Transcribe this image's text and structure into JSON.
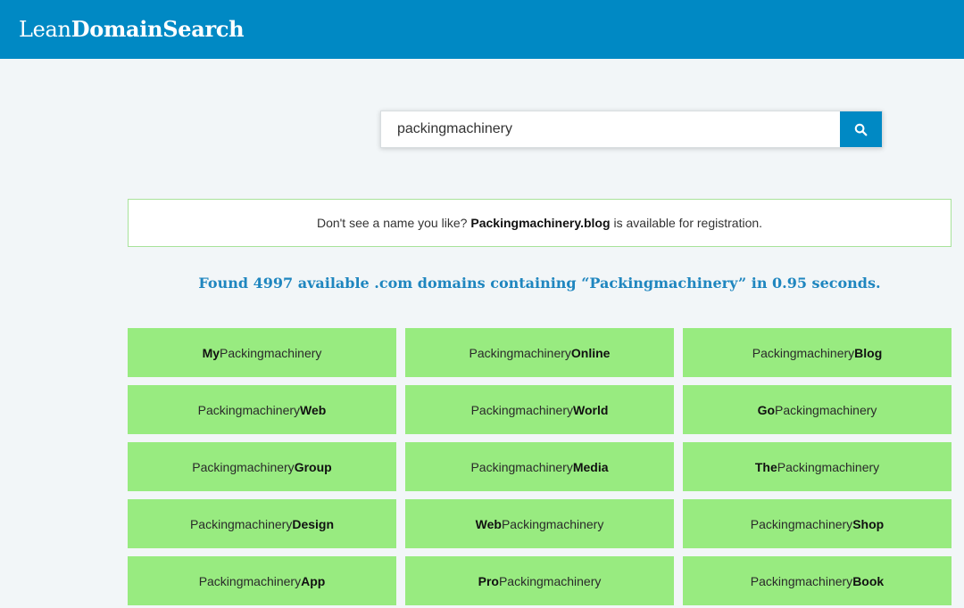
{
  "header": {
    "logo_light": "Lean",
    "logo_bold": "DomainSearch",
    "background": "#0089c4"
  },
  "search": {
    "value": "packingmachinery",
    "button_icon": "search-icon"
  },
  "notice": {
    "prefix": "Don't see a name you like?",
    "domain": "Packingmachinery.blog",
    "suffix": "is available for registration."
  },
  "results": {
    "summary": "Found 4997 available .com domains containing “Packingmachinery” in 0.95 seconds.",
    "card_color": "#98eb80",
    "items": [
      {
        "prefix": "My",
        "prefix_bold": true,
        "base": "Packingmachinery",
        "suffix": "",
        "suffix_bold": false
      },
      {
        "prefix": "",
        "prefix_bold": false,
        "base": "Packingmachinery",
        "suffix": "Online",
        "suffix_bold": true
      },
      {
        "prefix": "",
        "prefix_bold": false,
        "base": "Packingmachinery",
        "suffix": "Blog",
        "suffix_bold": true
      },
      {
        "prefix": "",
        "prefix_bold": false,
        "base": "Packingmachinery",
        "suffix": "Web",
        "suffix_bold": true
      },
      {
        "prefix": "",
        "prefix_bold": false,
        "base": "Packingmachinery",
        "suffix": "World",
        "suffix_bold": true
      },
      {
        "prefix": "Go",
        "prefix_bold": true,
        "base": "Packingmachinery",
        "suffix": "",
        "suffix_bold": false
      },
      {
        "prefix": "",
        "prefix_bold": false,
        "base": "Packingmachinery",
        "suffix": "Group",
        "suffix_bold": true
      },
      {
        "prefix": "",
        "prefix_bold": false,
        "base": "Packingmachinery",
        "suffix": "Media",
        "suffix_bold": true
      },
      {
        "prefix": "The",
        "prefix_bold": true,
        "base": "Packingmachinery",
        "suffix": "",
        "suffix_bold": false
      },
      {
        "prefix": "",
        "prefix_bold": false,
        "base": "Packingmachinery",
        "suffix": "Design",
        "suffix_bold": true
      },
      {
        "prefix": "Web",
        "prefix_bold": true,
        "base": "Packingmachinery",
        "suffix": "",
        "suffix_bold": false
      },
      {
        "prefix": "",
        "prefix_bold": false,
        "base": "Packingmachinery",
        "suffix": "Shop",
        "suffix_bold": true
      },
      {
        "prefix": "",
        "prefix_bold": false,
        "base": "Packingmachinery",
        "suffix": "App",
        "suffix_bold": true
      },
      {
        "prefix": "Pro",
        "prefix_bold": true,
        "base": "Packingmachinery",
        "suffix": "",
        "suffix_bold": false
      },
      {
        "prefix": "",
        "prefix_bold": false,
        "base": "Packingmachinery",
        "suffix": "Book",
        "suffix_bold": true
      }
    ]
  }
}
